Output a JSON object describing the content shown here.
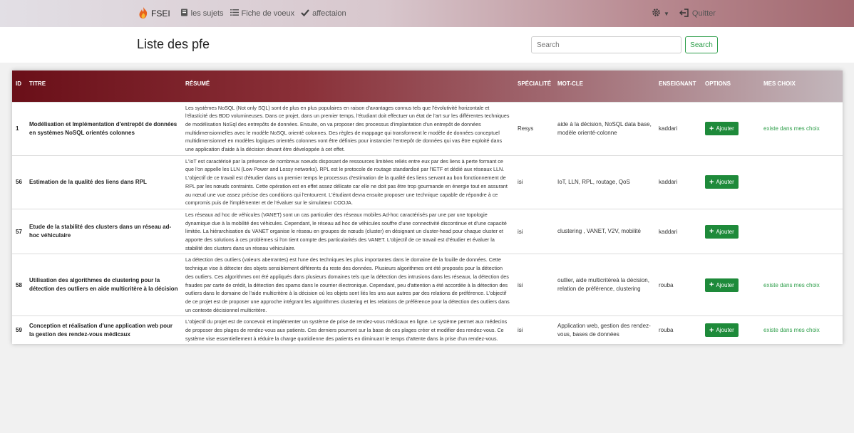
{
  "nav": {
    "brand": "FSEI",
    "links": [
      "les sujets",
      "Fiche de voeux",
      "affectaion"
    ],
    "quit": "Quitter"
  },
  "page": {
    "title": "Liste des pfe",
    "search_placeholder": "Search",
    "search_button": "Search"
  },
  "table": {
    "headers": {
      "id": "ID",
      "titre": "TITRE",
      "resume": "RÉSUMÉ",
      "specialite": "SPÉCIALITÉ",
      "motcle": "MOT-CLE",
      "enseignant": "ENSEIGNANT",
      "options": "OPTIONS",
      "choix": "MES CHOIX"
    },
    "add_label": "Ajouter",
    "rows": [
      {
        "id": "1",
        "titre": "Modélisation et Implémentation d'entrepôt de données en systèmes NoSQL orientés colonnes",
        "resume": "Les systèmes NoSQL (Not only SQL) sont de plus en plus populaires en raison d'avantages connus tels que l'évolutivité horizontale et l'élastícité des BDD volumineuses. Dans ce projet, dans un premier temps, l'étudiant doit effectuer un état de l'art sur les différentes techniques de modélisation NoSql des entrepôts de données. Ensuite, on va proposer des processus d'implantation d'un entrepôt de données multidimensionnelles avec le modèle NoSQL orienté colonnes. Des règles de mappage qui transforment le modèle de données conceptuel multidimensionnel en modèles logiques orientés colonnes vont être définies pour instancier l'entrepôt de données qui vas être exploité dans une application d'aide à la décision devant être développée à cet effet.",
        "specialite": "Resys",
        "motcle": "aide à la décision, NoSQL data base, modèle orienté-colonne",
        "enseignant": "kaddari",
        "choix": "existe dans mes choix"
      },
      {
        "id": "56",
        "titre": "Estimation de la qualité des liens dans RPL",
        "resume": "L'IoT est caractérisé par la présence de nombreux noeuds disposant de ressources limitées reliés entre eux par des liens à perte formant ce que l'on appelle les LLN (Low Power and Lossy networks). RPL est le protocole de routage standardisé par l'IETF et dédié aux réseaux LLN. L'objectif de ce travail est d'étudier dans un premier temps le processus d'estimation de la qualité des liens servant au bon fonctionnement de RPL par les nœuds contraints. Cette opération est en effet assez délicate car elle ne doit pas être trop gourmande en énergie tout en assurant au nœud une vue assez précise des conditions qui l'entourent. L'étudiant devra ensuite proposer une technique capable de répondre à ce compromis puis de l'implémenter et de l'évaluer sur le simulateur COOJA.",
        "specialite": "isi",
        "motcle": "IoT, LLN, RPL, routage, QoS",
        "enseignant": "kaddari",
        "choix": ""
      },
      {
        "id": "57",
        "titre": "Etude de la stabilité des clusters dans un réseau ad-hoc véhiculaire",
        "resume": "Les réseaux ad hoc de véhicules (VANET) sont un cas particulier des réseaux mobiles Ad-hoc caractérisés par une par une topologie dynamique due à la mobilité des véhicules. Cependant, le réseau ad hoc de véhicules souffre d'une connectivité discontinue et d'une capacité limitée. La hiérarchisation du VANET organise le réseau en groupes de nœuds (cluster) en désignant un cluster-head pour chaque cluster et apporte des solutions à ces problèmes si l'on tient compte des particularités des VANET. L'objectif de ce travail est d'étudier et évaluer la stabilité des clusters dans un réseau véhiculaire.",
        "specialite": "isi",
        "motcle": "clustering , VANET, V2V, mobilité",
        "enseignant": "kaddari",
        "choix": ""
      },
      {
        "id": "58",
        "titre": "Utilisation des algorithmes de clustering pour la détection des outliers en aide multicritère à la décision",
        "resume": "La détection des outliers (valeurs aberrantes) est l'une des techniques les plus importantes dans le domaine de la fouille de données. Cette technique vise à détecter des objets sensiblement différents du reste des données. Plusieurs algorithmes ont été proposés pour la détection des outliers. Ces algorithmes ont été appliqués dans plusieurs domaines tels que la détection des intrusions dans les réseaux, la détection des fraudes par carte de crédit, la détection des spams dans le courrier électronique. Cependant, peu d'attention a été accordée à la détection des outliers dans le domaine de l'aide multicritère à la décision où les objets sont liés les uns aux autres par des relations de préférence. L'objectif de ce projet est de proposer une approche intégrant les algorithmes clustering et les relations de préférence pour la détection des outliers dans un contexte décisionnel multicritère.",
        "specialite": "isi",
        "motcle": "outlier, aide multicritèreà la décision, relation de préférence, clustering",
        "enseignant": "rouba",
        "choix": "existe dans mes choix"
      },
      {
        "id": "59",
        "titre": "Conception et réalisation d'une application web pour la gestion des rendez-vous médicaux",
        "resume": "L'objectif du projet est de concevoir et implémenter un système de prise de rendez-vous médicaux en ligne. Le système permet aux médecins de proposer des plages de rendez-vous aux patients. Ces derniers pourront sur la base de ces plages créer et modifier des rendez-vous. Ce système vise essentiellement à réduire la charge quotidienne des patients en diminuant le temps d'attente dans la prise d'un rendez-vous.",
        "specialite": "isi",
        "motcle": "Application web, gestion des rendez-vous, bases de données",
        "enseignant": "rouba",
        "choix": "existe dans mes choix"
      }
    ]
  },
  "colors": {
    "accent_green": "#2e9e4a",
    "header_dark": "#6a0f18"
  },
  "icons": [
    "flame-logo-icon",
    "book-icon",
    "list-icon",
    "check-icon",
    "gear-icon",
    "logout-icon",
    "plus-icon"
  ]
}
